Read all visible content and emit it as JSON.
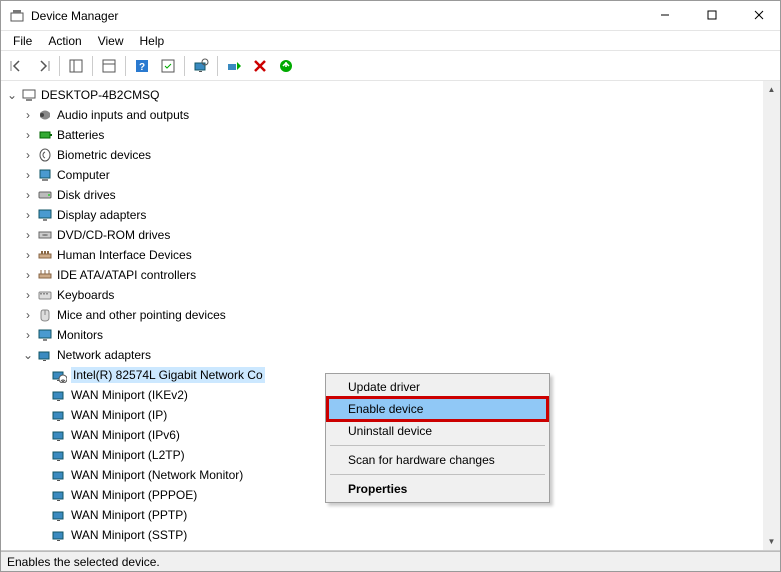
{
  "window": {
    "title": "Device Manager"
  },
  "menu": {
    "file": "File",
    "action": "Action",
    "view": "View",
    "help": "Help"
  },
  "tree": {
    "root": "DESKTOP-4B2CMSQ",
    "categories": [
      {
        "label": "Audio inputs and outputs"
      },
      {
        "label": "Batteries"
      },
      {
        "label": "Biometric devices"
      },
      {
        "label": "Computer"
      },
      {
        "label": "Disk drives"
      },
      {
        "label": "Display adapters"
      },
      {
        "label": "DVD/CD-ROM drives"
      },
      {
        "label": "Human Interface Devices"
      },
      {
        "label": "IDE ATA/ATAPI controllers"
      },
      {
        "label": "Keyboards"
      },
      {
        "label": "Mice and other pointing devices"
      },
      {
        "label": "Monitors"
      },
      {
        "label": "Network adapters"
      }
    ],
    "network_children": [
      {
        "label": "Intel(R) 82574L Gigabit Network Co",
        "selected": true,
        "disabled": true
      },
      {
        "label": "WAN Miniport (IKEv2)"
      },
      {
        "label": "WAN Miniport (IP)"
      },
      {
        "label": "WAN Miniport (IPv6)"
      },
      {
        "label": "WAN Miniport (L2TP)"
      },
      {
        "label": "WAN Miniport (Network Monitor)"
      },
      {
        "label": "WAN Miniport (PPPOE)"
      },
      {
        "label": "WAN Miniport (PPTP)"
      },
      {
        "label": "WAN Miniport (SSTP)"
      }
    ]
  },
  "context_menu": {
    "update": "Update driver",
    "enable": "Enable device",
    "uninstall": "Uninstall device",
    "scan": "Scan for hardware changes",
    "properties": "Properties"
  },
  "status": {
    "text": "Enables the selected device."
  }
}
